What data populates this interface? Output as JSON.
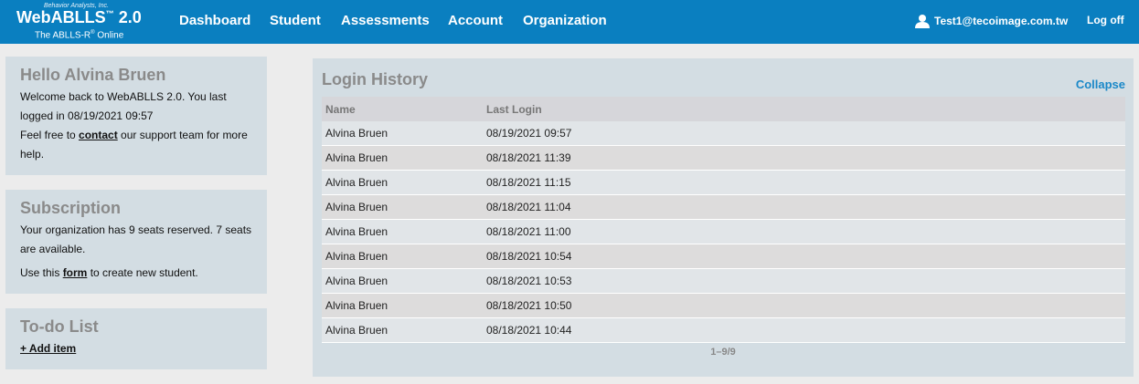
{
  "brand": {
    "maker": "Behavior Analysts, Inc.",
    "name": "WebABLLS",
    "tm": "™",
    "version": "2.0",
    "tagline_pre": "The ABLLS-R",
    "tagline_reg": "®",
    "tagline_post": " Online"
  },
  "nav": {
    "items": [
      {
        "label": "Dashboard"
      },
      {
        "label": "Student"
      },
      {
        "label": "Assessments"
      },
      {
        "label": "Account"
      },
      {
        "label": "Organization"
      }
    ],
    "user": "Test1@tecoimage.com.tw",
    "user_icon": "user-icon",
    "logoff": "Log off"
  },
  "hello": {
    "title": "Hello Alvina Bruen",
    "line1": "Welcome back to WebABLLS 2.0. You last logged in 08/19/2021 09:57",
    "support_pre": "Feel free to ",
    "support_link": "contact",
    "support_post": " our support team for more help."
  },
  "subscription": {
    "title": "Subscription",
    "seats": "Your organization has 9 seats reserved. 7 seats are available.",
    "form_pre": "Use this ",
    "form_link": "form",
    "form_post": " to create new student."
  },
  "todo": {
    "title": "To-do List",
    "add": "+ Add item"
  },
  "history": {
    "title": "Login History",
    "collapse": "Collapse",
    "columns": {
      "name": "Name",
      "last_login": "Last Login"
    },
    "rows": [
      {
        "name": "Alvina Bruen",
        "last_login": "08/19/2021 09:57"
      },
      {
        "name": "Alvina Bruen",
        "last_login": "08/18/2021 11:39"
      },
      {
        "name": "Alvina Bruen",
        "last_login": "08/18/2021 11:15"
      },
      {
        "name": "Alvina Bruen",
        "last_login": "08/18/2021 11:04"
      },
      {
        "name": "Alvina Bruen",
        "last_login": "08/18/2021 11:00"
      },
      {
        "name": "Alvina Bruen",
        "last_login": "08/18/2021 10:54"
      },
      {
        "name": "Alvina Bruen",
        "last_login": "08/18/2021 10:53"
      },
      {
        "name": "Alvina Bruen",
        "last_login": "08/18/2021 10:50"
      },
      {
        "name": "Alvina Bruen",
        "last_login": "08/18/2021 10:44"
      }
    ],
    "pager": "1–9/9"
  },
  "colors": {
    "topbar": "#0a7fc0",
    "panel": "#d3dde3",
    "accent_link": "#1a88c8"
  }
}
